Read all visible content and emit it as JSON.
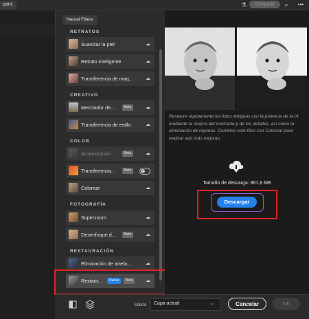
{
  "topbar": {
    "doc_tab": "pant.",
    "share_label": "Compartir",
    "flask_icon": "flask-icon",
    "search_icon": "search-icon",
    "more_icon": "more-icon"
  },
  "panel": {
    "title": "Neural Filters",
    "sections": [
      {
        "title": "RETRATOS",
        "items": [
          {
            "label": "Suavizar la piel"
          },
          {
            "label": "Retrato inteligente"
          },
          {
            "label": "Transferencia de maq..."
          }
        ]
      },
      {
        "title": "CREATIVO",
        "items": [
          {
            "label": "Mezclador de...",
            "badge": "Beta"
          },
          {
            "label": "Transferencia de estilo"
          }
        ]
      },
      {
        "title": "COLOR",
        "items": [
          {
            "label": "Armonización",
            "badge": "Beta",
            "disabled": true
          },
          {
            "label": "Transferencia...",
            "badge": "Beta",
            "toggle": true
          },
          {
            "label": "Colorear"
          }
        ]
      },
      {
        "title": "FOTOGRAFÍA",
        "items": [
          {
            "label": "Superzoom"
          },
          {
            "label": "Desenfoque d...",
            "badge": "Beta"
          }
        ]
      },
      {
        "title": "RESTAURACIÓN",
        "items": [
          {
            "label": "Eliminación de artefa..."
          },
          {
            "label": "Restaur...",
            "badge_new": "Nuevo",
            "badge": "Beta"
          }
        ]
      }
    ]
  },
  "detail": {
    "description": "Restaure rápidamente las fotos antiguas con la potencia de la IA mediante la mejora del contraste y de los detalles, así como la eliminación de rayones. Combine este filtro con Colorear para realizar aún más mejoras.",
    "download_size": "Tamaño de descarga: 861,8 MB",
    "download_button": "Descargar"
  },
  "footer": {
    "output_label": "Salida",
    "output_value": "Capa actual",
    "cancel": "Cancelar",
    "ok": "OK"
  },
  "colors": {
    "accent": "#2680eb",
    "highlight_red": "#e02424",
    "highlight_purple": "#9b59d0"
  }
}
